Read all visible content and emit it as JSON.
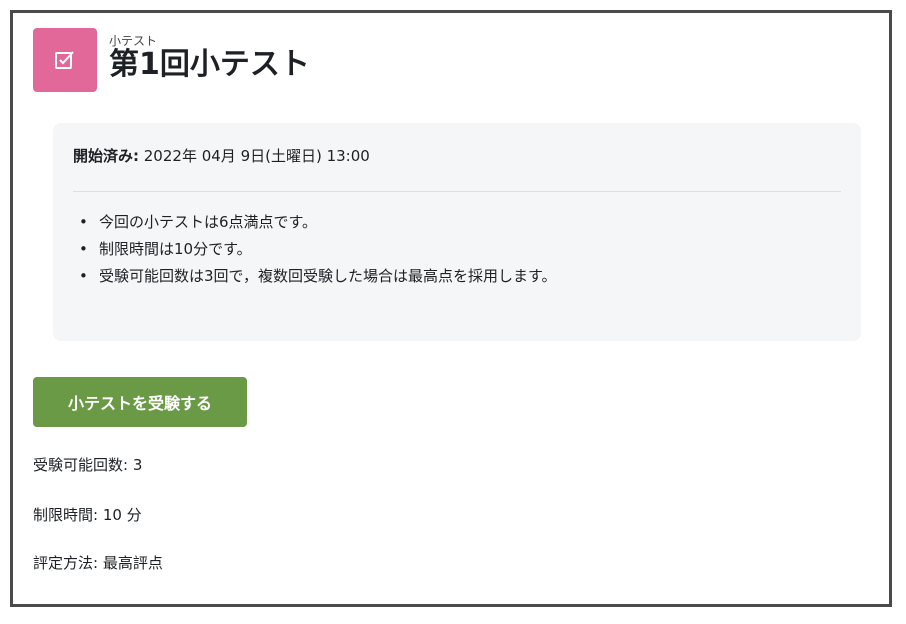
{
  "header": {
    "module_type": "小テスト",
    "title": "第1回小テスト",
    "icon": "quiz-checkbox-icon",
    "icon_color": "#e2689a"
  },
  "info": {
    "opened_label": "開始済み:",
    "opened_value": " 2022年 04月 9日(土曜日) 13:00",
    "intro_items": [
      "今回の小テストは6点満点です。",
      "制限時間は10分です。",
      "受験可能回数は3回で，複数回受験した場合は最高点を採用します。"
    ]
  },
  "actions": {
    "attempt_button": "小テストを受験する",
    "button_color": "#6a9a45"
  },
  "meta": {
    "attempts_allowed": "受験可能回数: 3",
    "time_limit": "制限時間: 10 分",
    "grading_method": "評定方法: 最高評点"
  }
}
